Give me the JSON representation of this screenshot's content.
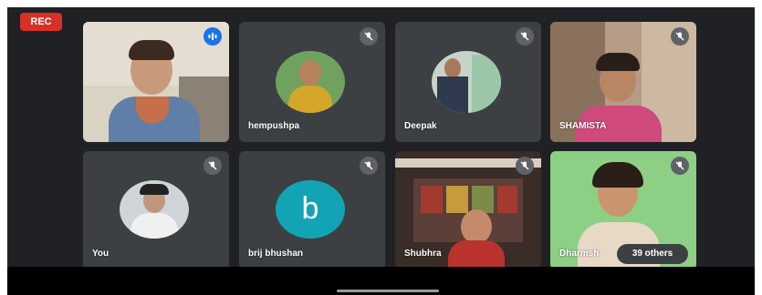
{
  "recording_badge": "REC",
  "participants": [
    {
      "name": "",
      "mic": "speaking"
    },
    {
      "name": "hempushpa",
      "mic": "muted"
    },
    {
      "name": "Deepak",
      "mic": "muted"
    },
    {
      "name": "SHAMISTA",
      "mic": "muted"
    },
    {
      "name": "You",
      "mic": "muted"
    },
    {
      "name": "brij bhushan",
      "avatar_letter": "b",
      "mic": "muted"
    },
    {
      "name": "Shubhra",
      "mic": "muted"
    },
    {
      "name": "Dharmsh",
      "mic": "muted"
    }
  ],
  "others_label": "39 others",
  "colors": {
    "background": "#202124",
    "tile": "#3c4043",
    "rec": "#d93025",
    "speaking": "#1a73e8",
    "avatar_teal": "#12a4b5"
  }
}
